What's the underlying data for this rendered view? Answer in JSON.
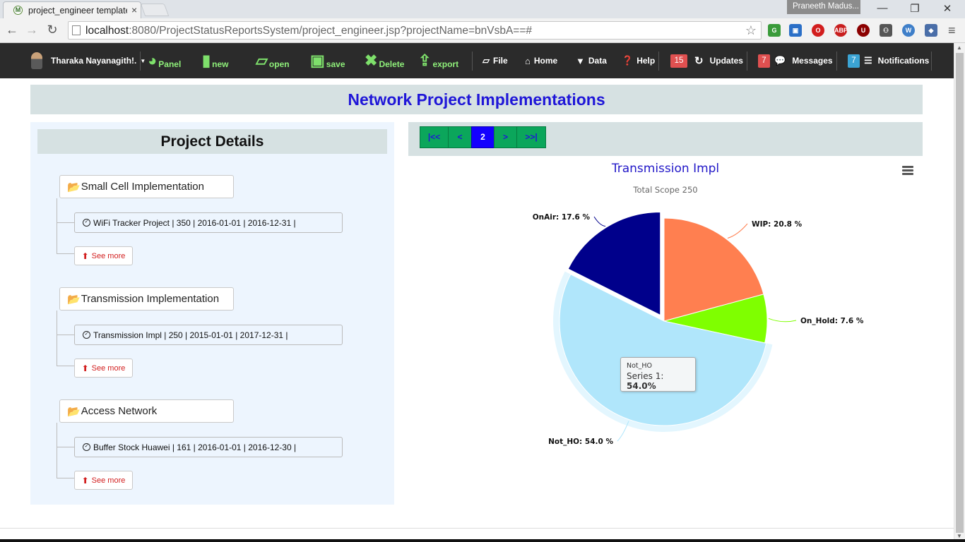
{
  "browser": {
    "tab_title": "project_engineer template",
    "tab_close": "×",
    "profile_name": "Praneeth Madus...",
    "url_host": "localhost",
    "url_rest": ":8080/ProjectStatusReportsSystem/project_engineer.jsp?projectName=bnVsbA==#",
    "window_buttons": [
      "—",
      "❐",
      "✕"
    ]
  },
  "navbar": {
    "user_name": "Tharaka Nayanagith!.",
    "panel_label": "Panel",
    "new_label": "new",
    "open_label": "open",
    "save_label": "save",
    "delete_label": "Delete",
    "export_label": "export",
    "file_label": "File",
    "home_label": "Home",
    "data_label": "Data",
    "help_label": "Help",
    "updates_count": "15",
    "updates_label": "Updates",
    "messages_count": "7",
    "messages_label": "Messages",
    "notifications_count": "7",
    "notifications_label": "Notifications",
    "colors": {
      "updates_badge": "#e05050",
      "messages_badge": "#e05050",
      "notifications_badge": "#3ba4d4"
    }
  },
  "page": {
    "title": "Network Project Implementations"
  },
  "project_details": {
    "heading": "Project Details",
    "see_more_label": "See more",
    "projects": [
      {
        "name": "Small Cell Implementation",
        "detail": "WiFi Tracker Project  | 350  | 2016-01-01  | 2016-12-31  |"
      },
      {
        "name": "Transmission Implementation",
        "detail": "Transmission Impl  | 250  | 2015-01-01  | 2017-12-31  |"
      },
      {
        "name": "Access Network",
        "detail": "Buffer Stock Huawei  | 161  | 2016-01-01  | 2016-12-30  |"
      }
    ]
  },
  "pager": {
    "first": "|<<",
    "prev": "<",
    "current": "2",
    "next": ">",
    "last": ">>|"
  },
  "chart_data": {
    "type": "pie",
    "title": "Transmission Impl",
    "subtitle": "Total Scope 250",
    "series_name": "Series 1",
    "slices": [
      {
        "name": "WIP",
        "value": 20.8,
        "label": "WIP: 20.8 %",
        "color": "#ff7f50"
      },
      {
        "name": "On_Hold",
        "value": 7.6,
        "label": "On_Hold: 7.6 %",
        "color": "#7fff00"
      },
      {
        "name": "Not_HO",
        "value": 54.0,
        "label": "Not_HO: 54.0 %",
        "color": "#b0e6fb",
        "highlighted": true
      },
      {
        "name": "OnAir",
        "value": 17.6,
        "label": "OnAir: 17.6 %",
        "color": "#00008b",
        "sliced": true
      }
    ],
    "tooltip": {
      "name": "Not_HO",
      "series": "Series 1",
      "value": "54.0%"
    }
  }
}
